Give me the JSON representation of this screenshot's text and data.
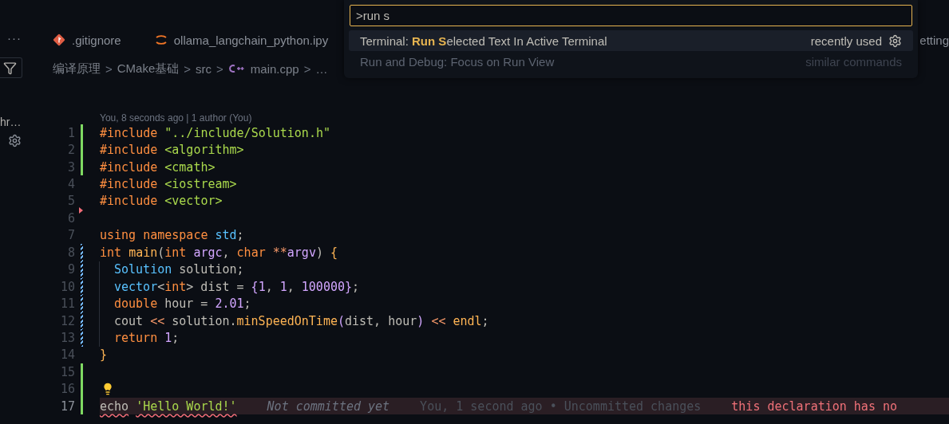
{
  "sidebar": {
    "more": "···",
    "label": "hr…"
  },
  "tabs": [
    {
      "label": ".gitignore"
    },
    {
      "label": "ollama_langchain_python.ipy"
    }
  ],
  "tab_edge": "etting",
  "breadcrumb": [
    {
      "label": "编译原理",
      "kind": "folder"
    },
    {
      "sep": ">",
      "label": "CMake基础",
      "kind": "folder"
    },
    {
      "sep": ">",
      "label": "src",
      "kind": "folder"
    },
    {
      "sep": ">",
      "label": "main.cpp",
      "kind": "file"
    },
    {
      "sep": ">",
      "label": "…",
      "kind": "symbol"
    }
  ],
  "blame_header": "You, 8 seconds ago | 1 author (You)",
  "code": [
    {
      "number": "1",
      "kind": "added",
      "tokens": [
        {
          "t": "#include ",
          "kind": "keyword"
        },
        {
          "t": "\"../include/Solution.h\"",
          "kind": "string"
        }
      ]
    },
    {
      "number": "2",
      "kind": "added",
      "tokens": [
        {
          "t": "#include ",
          "kind": "keyword"
        },
        {
          "t": "<algorithm>",
          "kind": "string"
        }
      ]
    },
    {
      "number": "3",
      "kind": "added",
      "tokens": [
        {
          "t": "#include ",
          "kind": "keyword"
        },
        {
          "t": "<cmath>",
          "kind": "string"
        }
      ]
    },
    {
      "number": "4",
      "kind": "unchanged",
      "tokens": [
        {
          "t": "#include ",
          "kind": "keyword"
        },
        {
          "t": "<iostream>",
          "kind": "string"
        }
      ]
    },
    {
      "number": "5",
      "kind": "unchanged",
      "tokens": [
        {
          "t": "#include ",
          "kind": "keyword"
        },
        {
          "t": "<vector>",
          "kind": "string"
        }
      ]
    },
    {
      "number": "6",
      "kind": "deleted"
    },
    {
      "number": "7",
      "kind": "unchanged",
      "tokens": [
        {
          "t": "using namespace ",
          "kind": "keyword"
        },
        {
          "t": "std",
          "kind": "type"
        },
        {
          "t": ";",
          "kind": "plain"
        }
      ]
    },
    {
      "number": "8",
      "kind": "modified",
      "tokens": [
        {
          "t": "int ",
          "kind": "keyword"
        },
        {
          "t": "main",
          "kind": "func"
        },
        {
          "t": "(",
          "kind": "plain"
        },
        {
          "t": "int ",
          "kind": "keyword"
        },
        {
          "t": "argc",
          "kind": "param"
        },
        {
          "t": ", ",
          "kind": "plain"
        },
        {
          "t": "char ",
          "kind": "keyword"
        },
        {
          "t": "**",
          "kind": "operator"
        },
        {
          "t": "argv",
          "kind": "param"
        },
        {
          "t": ") ",
          "kind": "plain"
        },
        {
          "t": "{",
          "kind": "func"
        }
      ]
    },
    {
      "number": "9",
      "kind": "modified",
      "indent": true,
      "tokens": [
        {
          "t": "Solution ",
          "kind": "type"
        },
        {
          "t": "solution;",
          "kind": "plain"
        }
      ]
    },
    {
      "number": "10",
      "kind": "modified",
      "indent": true,
      "tokens": [
        {
          "t": "vector",
          "kind": "type"
        },
        {
          "t": "<",
          "kind": "plain"
        },
        {
          "t": "int",
          "kind": "keyword"
        },
        {
          "t": "> dist = ",
          "kind": "plain"
        },
        {
          "t": "{",
          "kind": "param"
        },
        {
          "t": "1",
          "kind": "param"
        },
        {
          "t": ", ",
          "kind": "plain"
        },
        {
          "t": "1",
          "kind": "param"
        },
        {
          "t": ", ",
          "kind": "plain"
        },
        {
          "t": "100000",
          "kind": "param"
        },
        {
          "t": "}",
          "kind": "param"
        },
        {
          "t": ";",
          "kind": "plain"
        }
      ]
    },
    {
      "number": "11",
      "kind": "modified",
      "indent": true,
      "tokens": [
        {
          "t": "double ",
          "kind": "keyword"
        },
        {
          "t": "hour = ",
          "kind": "plain"
        },
        {
          "t": "2.01",
          "kind": "param"
        },
        {
          "t": ";",
          "kind": "plain"
        }
      ]
    },
    {
      "number": "12",
      "kind": "modified",
      "indent": true,
      "tokens": [
        {
          "t": "cout ",
          "kind": "plain"
        },
        {
          "t": "<<",
          "kind": "operator"
        },
        {
          "t": " solution.",
          "kind": "plain"
        },
        {
          "t": "minSpeedOnTime",
          "kind": "func"
        },
        {
          "t": "(",
          "kind": "param"
        },
        {
          "t": "dist, hour",
          "kind": "plain"
        },
        {
          "t": ") ",
          "kind": "param"
        },
        {
          "t": "<< ",
          "kind": "operator"
        },
        {
          "t": "endl",
          "kind": "func"
        },
        {
          "t": ";",
          "kind": "plain"
        }
      ]
    },
    {
      "number": "13",
      "kind": "modified",
      "indent": true,
      "tokens": [
        {
          "t": "return ",
          "kind": "keyword"
        },
        {
          "t": "1",
          "kind": "param"
        },
        {
          "t": ";",
          "kind": "plain"
        }
      ]
    },
    {
      "number": "14",
      "kind": "unchanged",
      "tokens": [
        {
          "t": "}",
          "kind": "func"
        }
      ]
    },
    {
      "number": "15",
      "kind": "added"
    },
    {
      "number": "16",
      "kind": "added",
      "lightbulb": true
    },
    {
      "number": "17",
      "kind": "added",
      "highlighted": true,
      "tokens": [
        {
          "t": "echo",
          "kind": "plain",
          "error": true
        },
        {
          "t": "'Hello World!'",
          "kind": "string",
          "error": true,
          "gap": true
        }
      ],
      "annotations": [
        {
          "t": "Not committed yet",
          "kind": "italic"
        },
        {
          "t": "You, 1 second ago • Uncommitted changes",
          "kind": "blame"
        },
        {
          "t": "this declaration has no",
          "kind": "error"
        }
      ]
    }
  ],
  "palette": {
    "query": ">run s",
    "items": [
      {
        "label": "Terminal: **Run S**elected Text In Active Terminal",
        "detail": "recently used",
        "selected": true,
        "gear": true
      },
      {
        "label": "Run and Debug: Focus on Run View",
        "detail": "similar commands",
        "selected": false,
        "gear": false
      }
    ]
  }
}
